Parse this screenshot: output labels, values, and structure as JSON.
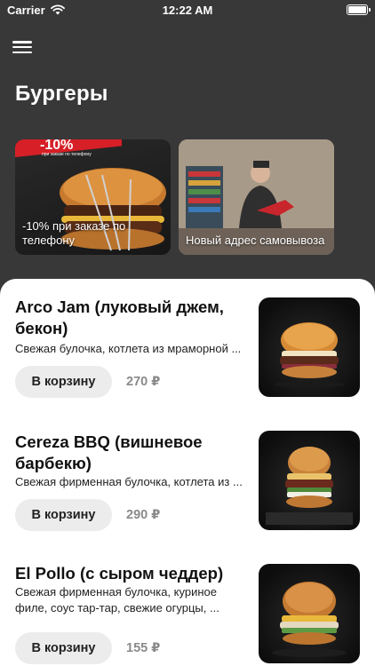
{
  "status_bar": {
    "carrier": "Carrier",
    "time": "12:22 AM"
  },
  "page": {
    "title": "Бургеры"
  },
  "promos": [
    {
      "caption": "-10% при заказе по телефону",
      "banner": "-10%",
      "banner_sub": "при заказе по телефону"
    },
    {
      "caption": "Новый адрес самовывоза"
    }
  ],
  "items": [
    {
      "name": "Arco Jam (луковый джем, бекон)",
      "description": "Свежая булочка, котлета из мраморной ...",
      "cart_label": "В корзину",
      "price": "270 ₽"
    },
    {
      "name": "Cereza BBQ (вишневое барбекю)",
      "description": "Свежая фирменная булочка, котлета из ...",
      "cart_label": "В корзину",
      "price": "290 ₽"
    },
    {
      "name": "El Pollo (с сыром чеддер)",
      "description": "Свежая фирменная булочка, куриное филе, соус тар-тар, свежие огурцы, ...",
      "cart_label": "В корзину",
      "price": "155 ₽"
    }
  ],
  "colors": {
    "background": "#383838",
    "sheet": "#ffffff",
    "promo_banner": "#d61f26"
  }
}
